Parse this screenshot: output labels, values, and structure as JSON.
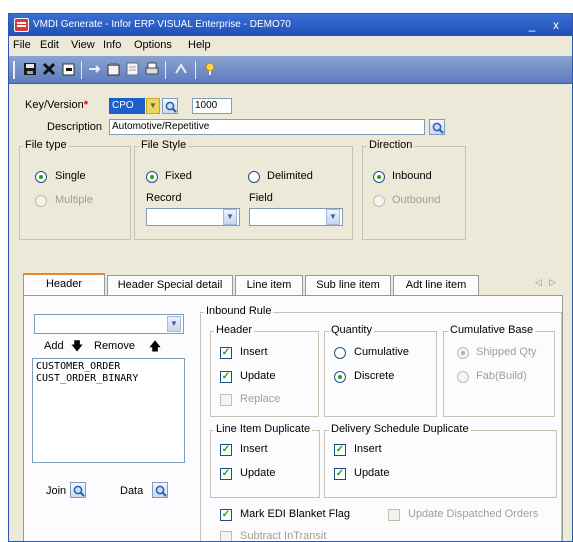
{
  "window": {
    "title": "VMDI Generate - Infor ERP VISUAL Enterprise - DEMO70",
    "minimize_glyph": "_",
    "close_glyph": "x"
  },
  "menu": [
    "File",
    "Edit",
    "View",
    "Info",
    "Options",
    "Help"
  ],
  "toolbar": {
    "icons": [
      "save-icon",
      "delete-icon",
      "new-icon",
      "arrow-icon",
      "properties-icon",
      "preview-icon",
      "print-icon",
      "tile-icon",
      "help-icon"
    ]
  },
  "form": {
    "key_label": "Key/Version",
    "required_marker": "*",
    "key_value": "CPO",
    "version_value": "1000",
    "description_label": "Description",
    "description_value": "Automotive/Repetitive"
  },
  "file_type": {
    "title": "File type",
    "options": [
      {
        "label": "Single",
        "selected": true,
        "enabled": true
      },
      {
        "label": "Multiple",
        "selected": false,
        "enabled": false
      }
    ]
  },
  "file_style": {
    "title": "File Style",
    "fixed_label": "Fixed",
    "fixed_selected": true,
    "delimited_label": "Delimited",
    "delimited_selected": false,
    "record_label": "Record",
    "field_label": "Field"
  },
  "direction": {
    "title": "Direction",
    "inbound_label": "Inbound",
    "inbound_selected": true,
    "outbound_label": "Outbound",
    "outbound_enabled": false
  },
  "tabs": [
    "Header",
    "Header Special detail",
    "Line item",
    "Sub line item",
    "Adt line item"
  ],
  "active_tab": "Header",
  "tab_scroll": {
    "left": "◁",
    "right": "▷"
  },
  "left_panel": {
    "add_label": "Add",
    "remove_label": "Remove",
    "list_items": [
      "CUSTOMER_ORDER",
      "CUST_ORDER_BINARY"
    ],
    "join_label": "Join",
    "data_label": "Data"
  },
  "inbound_rule": {
    "title": "Inbound Rule",
    "header": {
      "title": "Header",
      "insert_label": "Insert",
      "insert_checked": true,
      "update_label": "Update",
      "update_checked": true,
      "replace_label": "Replace",
      "replace_checked": false
    },
    "quantity": {
      "title": "Quantity",
      "cumulative_label": "Cumulative",
      "cumulative_selected": false,
      "discrete_label": "Discrete",
      "discrete_selected": true
    },
    "cumulative_base": {
      "title": "Cumulative Base",
      "shipped_label": "Shipped Qty",
      "shipped_selected": true,
      "fab_label": "Fab(Build)",
      "fab_selected": false
    },
    "line_item_duplicate": {
      "title": "Line Item Duplicate",
      "insert_label": "Insert",
      "insert_checked": true,
      "update_label": "Update",
      "update_checked": true
    },
    "delivery_schedule_duplicate": {
      "title": "Delivery Schedule Duplicate",
      "insert_label": "Insert",
      "insert_checked": true,
      "update_label": "Update",
      "update_checked": true
    },
    "mark_edi_label": "Mark EDI Blanket Flag",
    "mark_edi_checked": true,
    "update_dispatched_label": "Update Dispatched Orders",
    "subtract_in_transit_label": "Subtract InTransit"
  },
  "glyphs": {
    "check": "✓",
    "down": "🡇",
    "up": "🡅"
  }
}
